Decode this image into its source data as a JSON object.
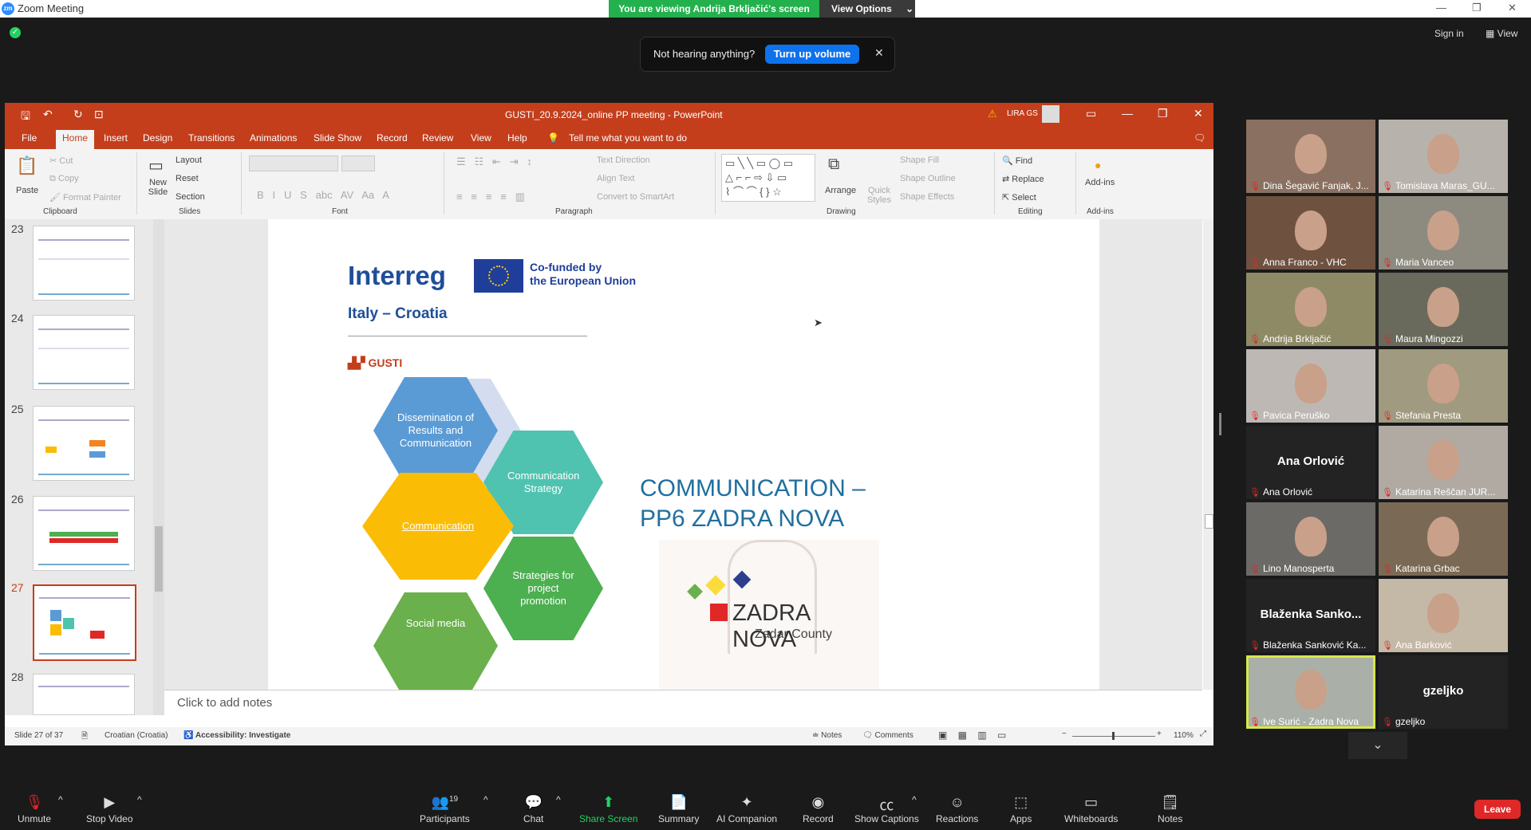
{
  "zoom": {
    "window_title": "Zoom Meeting",
    "banner": "You are viewing Andrija Brkljačić's screen",
    "view_options": "View Options",
    "sign_in": "Sign in",
    "view": "View",
    "toast": {
      "text": "Not hearing anything?",
      "button": "Turn up volume"
    }
  },
  "ppt": {
    "title": "GUSTI_20.9.2024_online PP meeting  -  PowerPoint",
    "user": "LIRA GS",
    "tabs": [
      "File",
      "Home",
      "Insert",
      "Design",
      "Transitions",
      "Animations",
      "Slide Show",
      "Record",
      "Review",
      "View",
      "Help"
    ],
    "tell_me": "Tell me what you want to do",
    "ribbon": {
      "paste": "Paste",
      "cut": "Cut",
      "copy": "Copy",
      "format_painter": "Format Painter",
      "clipboard": "Clipboard",
      "new_slide": "New Slide",
      "layout": "Layout",
      "reset": "Reset",
      "section": "Section",
      "slides": "Slides",
      "font": "Font",
      "text_direction": "Text Direction",
      "align_text": "Align Text",
      "convert_smartart": "Convert to SmartArt",
      "paragraph": "Paragraph",
      "arrange": "Arrange",
      "quick_styles": "Quick Styles",
      "shape_fill": "Shape Fill",
      "shape_outline": "Shape Outline",
      "shape_effects": "Shape Effects",
      "drawing": "Drawing",
      "find": "Find",
      "replace": "Replace",
      "select": "Select",
      "editing": "Editing",
      "add_ins": "Add-ins",
      "add_ins_group": "Add-ins"
    },
    "thumb_numbers": [
      "23",
      "24",
      "25",
      "26",
      "27",
      "28"
    ],
    "slide": {
      "interreg": "Interreg",
      "cofunded": "Co-funded by\nthe European Union",
      "program": "Italy – Croatia",
      "gusti": "GUSTI",
      "hex1": "Dissemination of Results and Communication",
      "hex2": "Communication Strategy",
      "hex3": "Communication",
      "hex4": "Strategies for project promotion",
      "hex5": "Social media",
      "heading_line1": "COMMUNICATION –",
      "heading_line2": "PP6 ZADRA NOVA",
      "logo_name": "ZADRA NOVA",
      "logo_sub": "Zadar County"
    },
    "notes_placeholder": "Click to add notes",
    "status": {
      "slide": "Slide 27 of 37",
      "language": "Croatian (Croatia)",
      "accessibility": "Accessibility: Investigate",
      "notes": "Notes",
      "comments": "Comments",
      "zoom": "110%"
    }
  },
  "participants": [
    {
      "name": "Dina Šegavić Fanjak, J...",
      "video": true
    },
    {
      "name": "Tomislava Maras_GU...",
      "video": true
    },
    {
      "name": "Anna Franco - VHC",
      "video": true
    },
    {
      "name": "Maria Vanceo",
      "video": true
    },
    {
      "name": "Andrija Brkljačić",
      "video": true
    },
    {
      "name": "Maura Mingozzi",
      "video": true
    },
    {
      "name": "Pavica Peruško",
      "video": true
    },
    {
      "name": "Stefania Presta",
      "video": true
    },
    {
      "name": "Ana Orlović",
      "video": false,
      "display": "Ana Orlović"
    },
    {
      "name": "Katarina Reščan JUR...",
      "video": true
    },
    {
      "name": "Lino Manosperta",
      "video": true
    },
    {
      "name": "Katarina Grbac",
      "video": true
    },
    {
      "name": "Blaženka Sanković Ka...",
      "video": false,
      "display": "Blaženka Sanko..."
    },
    {
      "name": "Ana Barković",
      "video": true
    },
    {
      "name": "Ive Surić -  Zadra Nova",
      "video": true,
      "active": true
    },
    {
      "name": "gzeljko",
      "video": false,
      "display": "gzeljko"
    }
  ],
  "toolbar": {
    "unmute": "Unmute",
    "stop_video": "Stop Video",
    "participants": "Participants",
    "participant_count": "19",
    "chat": "Chat",
    "share_screen": "Share Screen",
    "summary": "Summary",
    "ai_companion": "AI Companion",
    "record": "Record",
    "show_captions": "Show Captions",
    "reactions": "Reactions",
    "apps": "Apps",
    "whiteboards": "Whiteboards",
    "notes": "Notes",
    "leave": "Leave"
  },
  "colors": {
    "ppt_accent": "#c43e1c",
    "zoom_green": "#23b14d",
    "leave": "#e02828",
    "hex_blue": "#5b9bd5",
    "hex_teal": "#4fc3b0",
    "hex_yellow": "#fbbc05",
    "hex_green": "#4caf50",
    "heading": "#1f6f9f"
  }
}
